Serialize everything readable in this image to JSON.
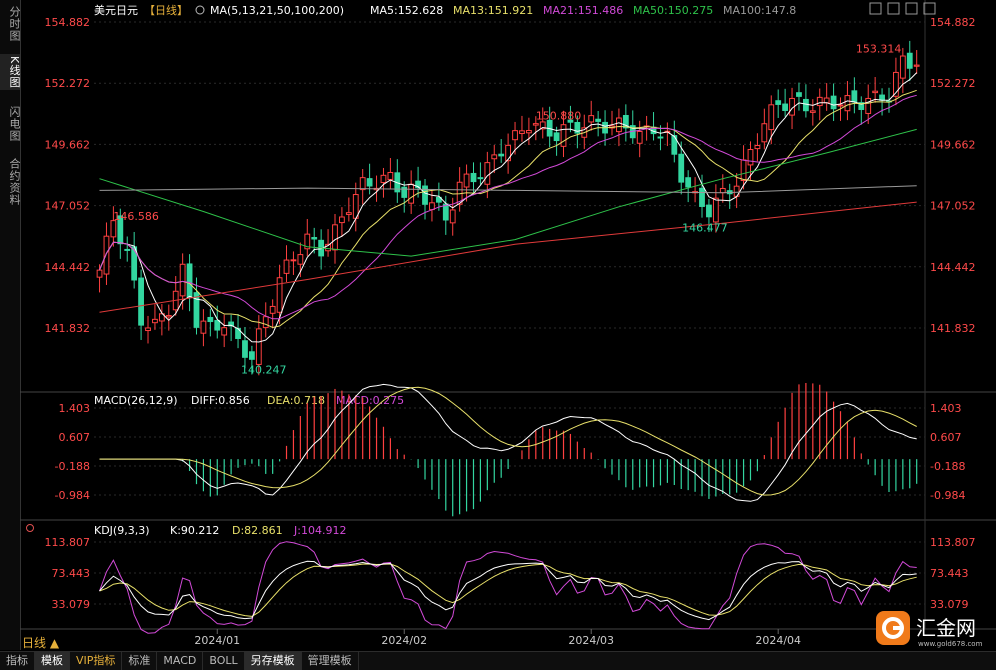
{
  "left_tabs": [
    {
      "label": "分时图",
      "active": false
    },
    {
      "label": "K线图",
      "active": true
    },
    {
      "label": "闪电图",
      "active": false
    },
    {
      "label": "合约资料",
      "active": false
    }
  ],
  "header": {
    "symbol": "美元日元",
    "period_tag": "【日线】",
    "ma_label": "MA(5,13,21,50,100,200)",
    "ma5": "MA5:152.628",
    "ma13": "MA13:151.921",
    "ma21": "MA21:151.486",
    "ma50": "MA50:150.275",
    "ma100": "MA100:147.8"
  },
  "price_axis": [
    "154.882",
    "152.272",
    "149.662",
    "147.052",
    "144.442",
    "141.832"
  ],
  "price_annotations": {
    "high1": "146.586",
    "low1": "140.247",
    "high2": "150.880",
    "low2": "146.477",
    "high3": "153.314"
  },
  "macd": {
    "label": "MACD(26,12,9)",
    "diff": "DIFF:0.856",
    "dea": "DEA:0.718",
    "macd": "MACD:0.275",
    "axis": [
      "1.403",
      "0.607",
      "-0.188",
      "-0.984"
    ]
  },
  "kdj": {
    "label": "KDJ(9,3,3)",
    "k": "K:90.212",
    "d": "D:82.861",
    "j": "J:104.912",
    "axis": [
      "113.807",
      "73.443",
      "33.079"
    ]
  },
  "date_axis": [
    "2024/01",
    "2024/02",
    "2024/03",
    "2024/04"
  ],
  "period_button": "日线 ▲",
  "bottom_tabs": [
    {
      "label": "指标",
      "active": false
    },
    {
      "label": "模板",
      "active": true
    },
    {
      "label": "VIP指标",
      "active": false,
      "vip": true
    },
    {
      "label": "标准",
      "active": false
    },
    {
      "label": "MACD",
      "active": false
    },
    {
      "label": "BOLL",
      "active": false
    },
    {
      "label": "另存模板",
      "active": true
    },
    {
      "label": "管理模板",
      "active": false
    }
  ],
  "logo": {
    "name": "汇金网",
    "url": "www.gold678.com"
  },
  "colors": {
    "up": "#ff4040",
    "down": "#33d6a0",
    "ma5": "#ffffff",
    "ma13": "#e8e06a",
    "ma21": "#d24ad8",
    "ma50": "#2ec24a",
    "ma100": "#9a9a9a",
    "ma200": "#e03a3a",
    "axis_text": "#ff4a4a"
  }
}
